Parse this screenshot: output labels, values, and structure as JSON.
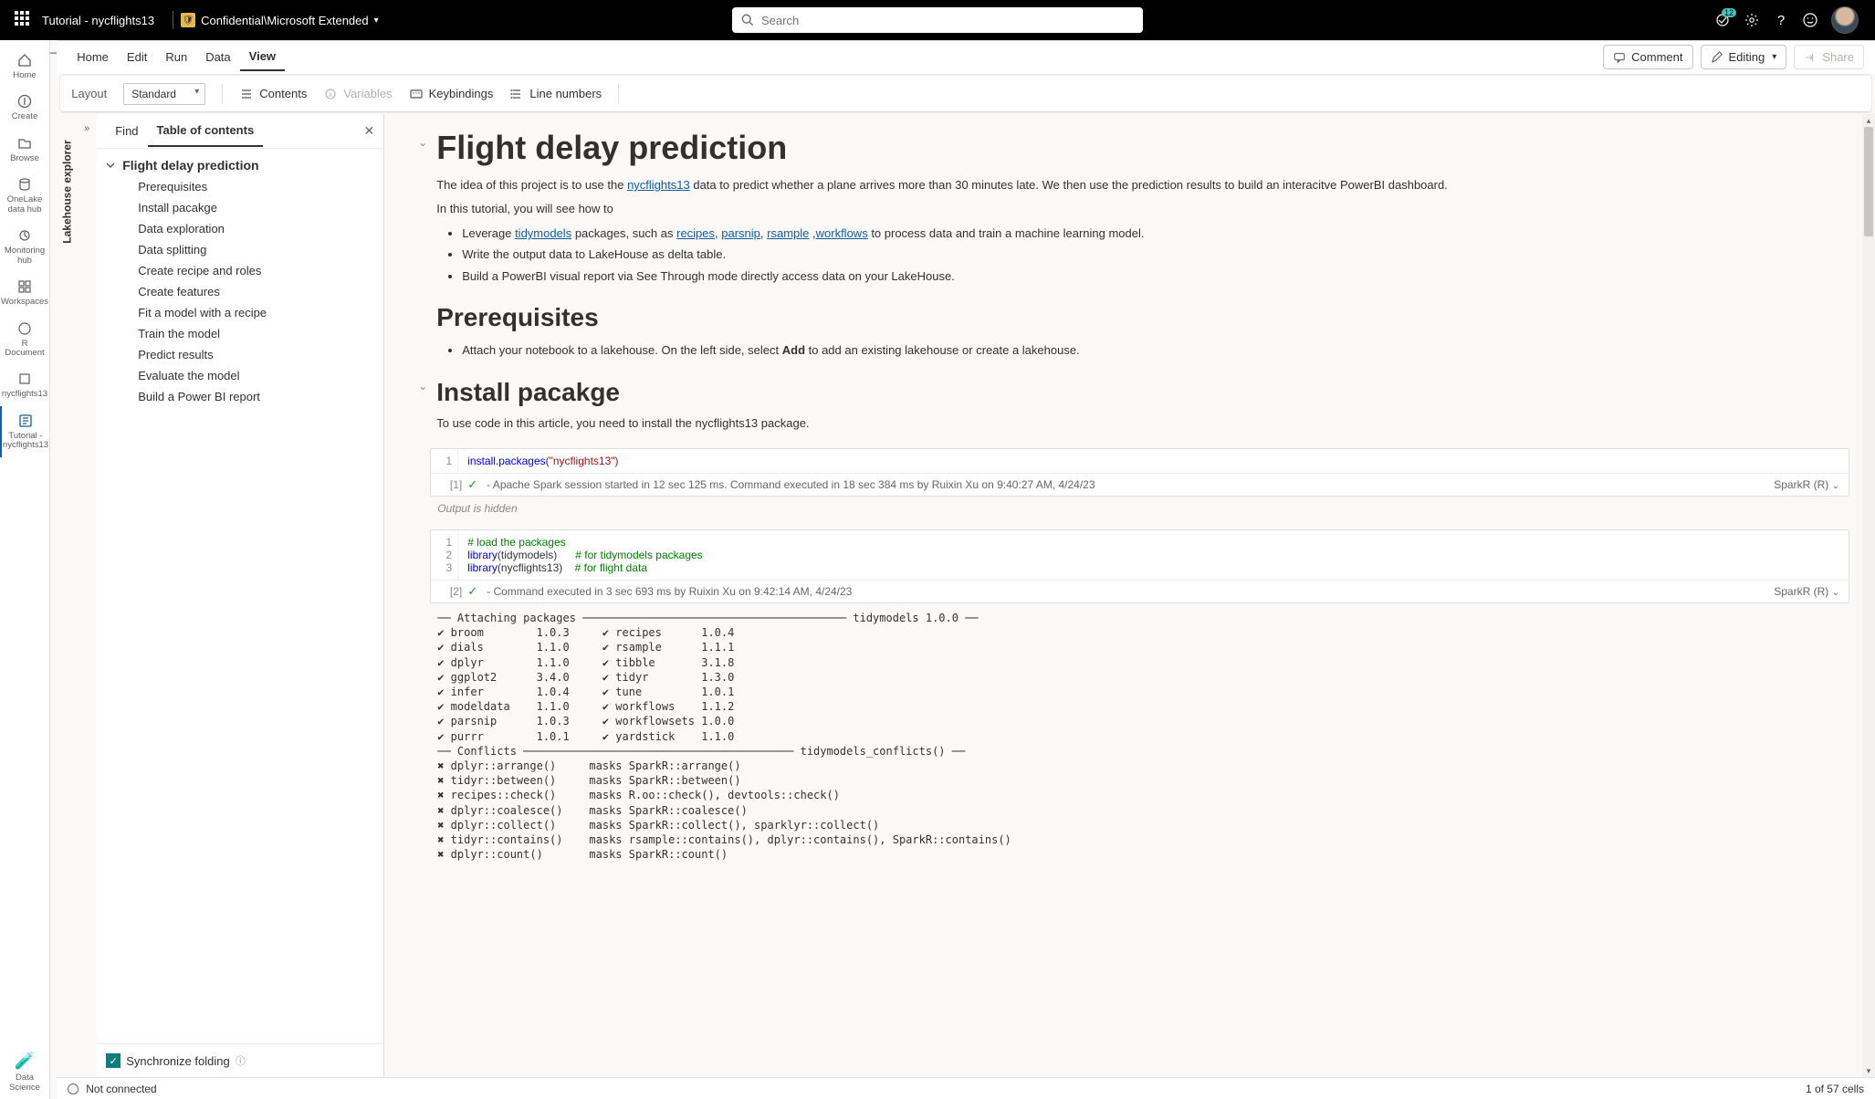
{
  "header": {
    "doc_title": "Tutorial - nycflights13",
    "sensitivity_label": "Confidential\\Microsoft Extended",
    "search_placeholder": "Search",
    "notif_count": "12"
  },
  "rail": {
    "items": [
      {
        "label": "Home"
      },
      {
        "label": "Create"
      },
      {
        "label": "Browse"
      },
      {
        "label": "OneLake data hub"
      },
      {
        "label": "Monitoring hub"
      },
      {
        "label": "Workspaces"
      },
      {
        "label": "R Document"
      },
      {
        "label": "nycflights13"
      },
      {
        "label": "Tutorial - nycflights13"
      }
    ],
    "data_science": "Data Science"
  },
  "ribbon": {
    "tabs": [
      "Home",
      "Edit",
      "Run",
      "Data",
      "View"
    ],
    "active": 4,
    "comment": "Comment",
    "editing": "Editing",
    "share": "Share"
  },
  "toolbar": {
    "layout_label": "Layout",
    "layout_value": "Standard",
    "contents": "Contents",
    "variables": "Variables",
    "keybindings": "Keybindings",
    "line_numbers": "Line numbers"
  },
  "side": {
    "lakehouse": "Lakehouse explorer"
  },
  "toc": {
    "tabs": {
      "find": "Find",
      "toc": "Table of contents"
    },
    "h1": "Flight delay prediction",
    "items": [
      "Prerequisites",
      "Install pacakge",
      "Data exploration",
      "Data splitting",
      "Create recipe and roles",
      "Create features",
      "Fit a model with a recipe",
      "Train the model",
      "Predict results",
      "Evaluate the model",
      "Build a Power BI report"
    ],
    "sync_label": "Synchronize folding"
  },
  "notebook": {
    "title": "Flight delay prediction",
    "intro_pre": "The idea of this project is to use the ",
    "intro_link": "nycflights13",
    "intro_post": " data to predict whether a plane arrives more than 30 minutes late. We then use the prediction results to build an interacitve PowerBI dashboard.",
    "tutorial_line": "In this tutorial, you will see how to",
    "bullets": {
      "b1_pre": "Leverage ",
      "b1_l1": "tidymodels",
      "b1_mid": " packages, such as ",
      "b1_l2": "recipes",
      "b1_l3": "parsnip",
      "b1_l4": "rsample",
      "b1_l5": "workflows",
      "b1_post": " to process data and train a machine learning model.",
      "b2": "Write the output data to LakeHouse as delta table.",
      "b3": "Build a PowerBI visual report via See Through mode directly access data on your LakeHouse."
    },
    "prereq_h": "Prerequisites",
    "prereq_b_pre": "Attach your notebook to a lakehouse. On the left side, select ",
    "prereq_b_bold": "Add",
    "prereq_b_post": " to add an existing lakehouse or create a lakehouse.",
    "install_h": "Install pacakge",
    "install_p": "To use code in this article, you need to install the nycflights13 package.",
    "cell1": {
      "idx": "[1]",
      "line1": "1",
      "code_fn": "install.packages",
      "code_str": "\"nycflights13\"",
      "status": " - Apache Spark session started in 12 sec 125 ms. Command executed in 18 sec 384 ms by Ruixin Xu on 9:40:27 AM, 4/24/23",
      "lang": "SparkR (R)",
      "output_hidden": "Output is hidden"
    },
    "cell2": {
      "idx": "[2]",
      "status": " - Command executed in 3 sec 693 ms by Ruixin Xu on 9:42:14 AM, 4/24/23",
      "lang": "SparkR (R)",
      "output": "── Attaching packages ──────────────────────────────────────── tidymodels 1.0.0 ──\n✔ broom        1.0.3     ✔ recipes      1.0.4\n✔ dials        1.1.0     ✔ rsample      1.1.1\n✔ dplyr        1.1.0     ✔ tibble       3.1.8\n✔ ggplot2      3.4.0     ✔ tidyr        1.3.0\n✔ infer        1.0.4     ✔ tune         1.0.1\n✔ modeldata    1.1.0     ✔ workflows    1.1.2\n✔ parsnip      1.0.3     ✔ workflowsets 1.0.0\n✔ purrr        1.0.1     ✔ yardstick    1.1.0\n── Conflicts ───────────────────────────────────────── tidymodels_conflicts() ──\n✖ dplyr::arrange()     masks SparkR::arrange()\n✖ tidyr::between()     masks SparkR::between()\n✖ recipes::check()     masks R.oo::check(), devtools::check()\n✖ dplyr::coalesce()    masks SparkR::coalesce()\n✖ dplyr::collect()     masks SparkR::collect(), sparklyr::collect()\n✖ tidyr::contains()    masks rsample::contains(), dplyr::contains(), SparkR::contains()\n✖ dplyr::count()       masks SparkR::count()"
    }
  },
  "status": {
    "not_connected": "Not connected",
    "cell_count": "1 of 57 cells"
  }
}
